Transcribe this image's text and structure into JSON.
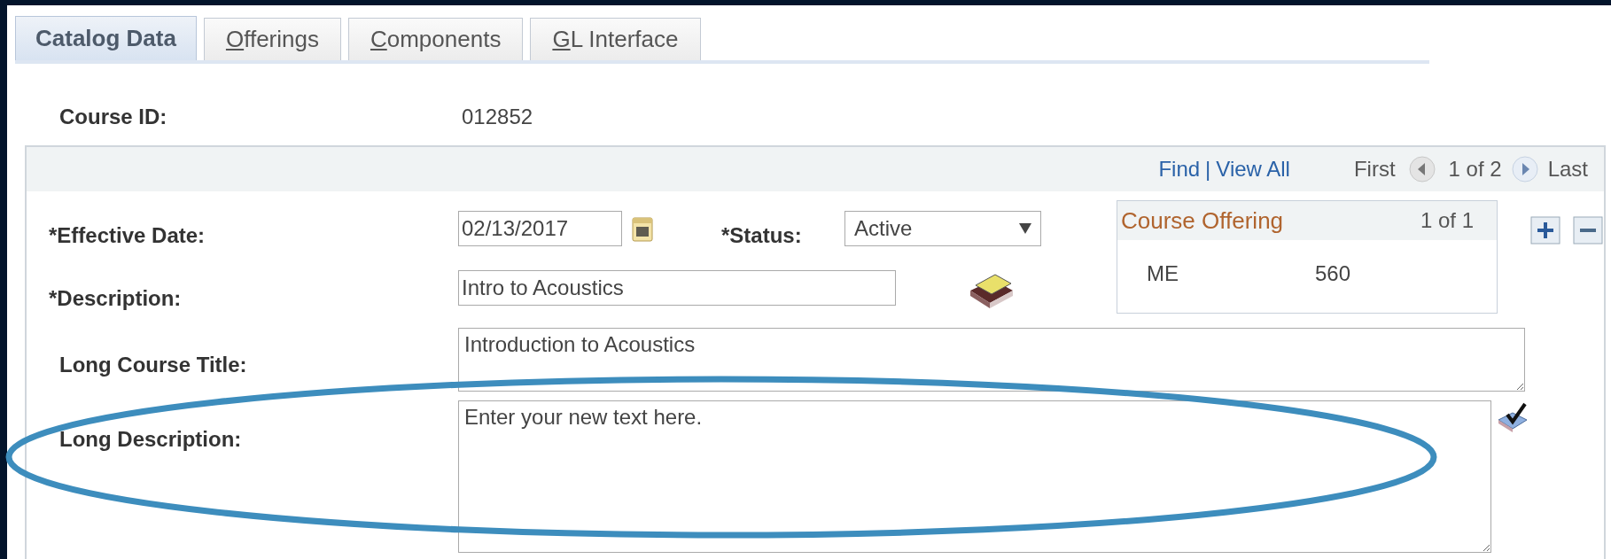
{
  "tabs": [
    {
      "label_rest": "Catalog Data",
      "selected": true
    },
    {
      "access_key": "O",
      "label_rest": "fferings",
      "selected": false
    },
    {
      "access_key": "C",
      "label_rest": "omponents",
      "selected": false
    },
    {
      "access_key": "G",
      "label_rest": "L Interface",
      "selected": false
    }
  ],
  "course_id": {
    "label": "Course ID:",
    "value": "012852"
  },
  "pager": {
    "find": "Find",
    "separator": "|",
    "view_all": "View All",
    "first": "First",
    "position": "1 of 2",
    "last": "Last"
  },
  "effective_date": {
    "label": "*Effective Date:",
    "value": "02/13/2017"
  },
  "status": {
    "label": "*Status:",
    "value": "Active"
  },
  "description": {
    "label": "*Description:",
    "value": "Intro to Acoustics"
  },
  "course_offering": {
    "title": "Course Offering",
    "count": "1 of 1",
    "subject": "ME",
    "catalog_nbr": "560"
  },
  "long_course_title": {
    "label": "Long Course Title:",
    "value": "Introduction to Acoustics"
  },
  "long_description": {
    "label": "Long Description:",
    "value": "Enter your new text here."
  }
}
